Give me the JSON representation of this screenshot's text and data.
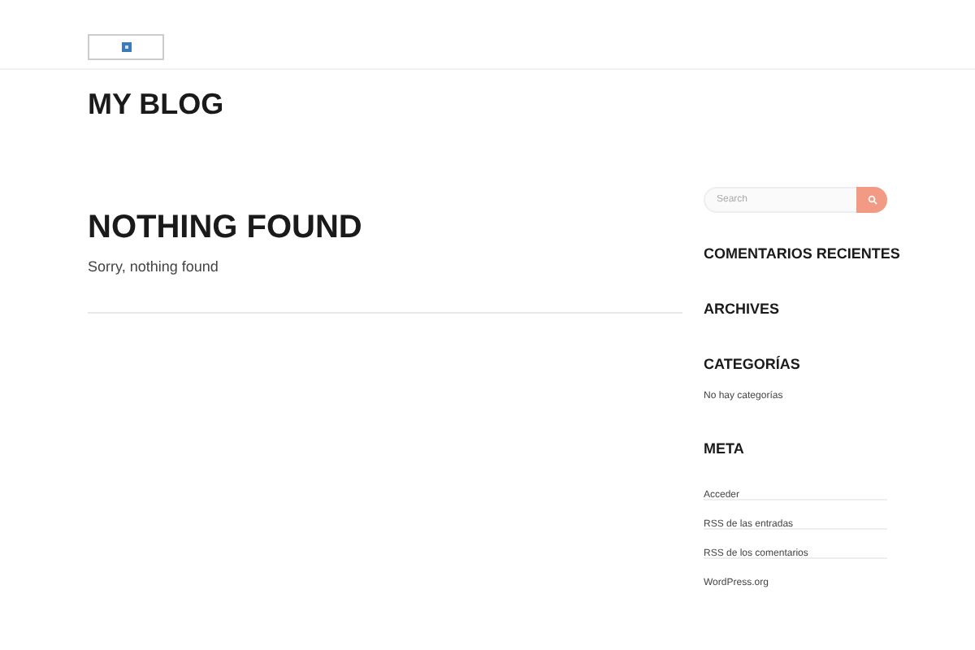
{
  "site_title": "MY BLOG",
  "main": {
    "heading": "NOTHING FOUND",
    "message": "Sorry, nothing found"
  },
  "sidebar": {
    "search": {
      "placeholder": "Search"
    },
    "widgets": [
      {
        "title": "COMENTARIOS RECIENTES"
      },
      {
        "title": "ARCHIVES"
      },
      {
        "title": "CATEGORÍAS",
        "text": "No hay categorías"
      },
      {
        "title": "META",
        "links": [
          "Acceder",
          "RSS de las entradas",
          "RSS de los comentarios",
          "WordPress.org"
        ]
      }
    ]
  }
}
